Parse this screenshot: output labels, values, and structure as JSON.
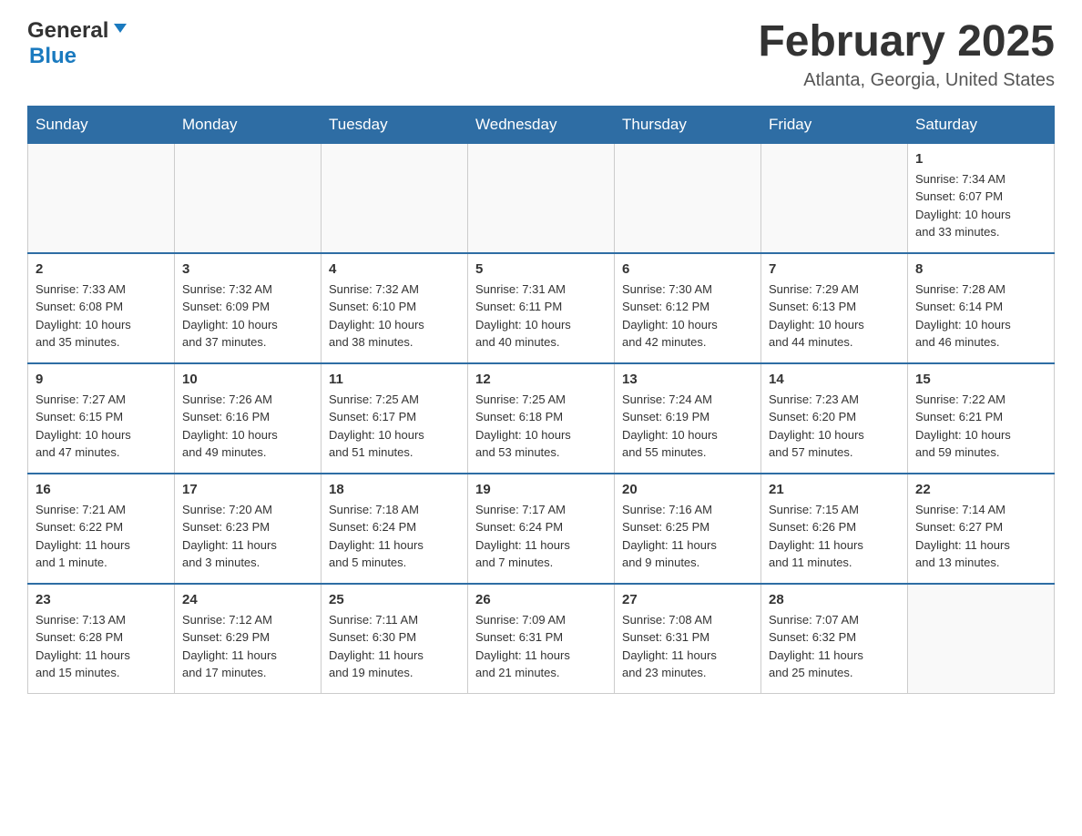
{
  "header": {
    "logo_general": "General",
    "logo_blue": "Blue",
    "month_title": "February 2025",
    "location": "Atlanta, Georgia, United States"
  },
  "weekdays": [
    "Sunday",
    "Monday",
    "Tuesday",
    "Wednesday",
    "Thursday",
    "Friday",
    "Saturday"
  ],
  "weeks": [
    {
      "days": [
        {
          "number": "",
          "info": ""
        },
        {
          "number": "",
          "info": ""
        },
        {
          "number": "",
          "info": ""
        },
        {
          "number": "",
          "info": ""
        },
        {
          "number": "",
          "info": ""
        },
        {
          "number": "",
          "info": ""
        },
        {
          "number": "1",
          "info": "Sunrise: 7:34 AM\nSunset: 6:07 PM\nDaylight: 10 hours\nand 33 minutes."
        }
      ]
    },
    {
      "days": [
        {
          "number": "2",
          "info": "Sunrise: 7:33 AM\nSunset: 6:08 PM\nDaylight: 10 hours\nand 35 minutes."
        },
        {
          "number": "3",
          "info": "Sunrise: 7:32 AM\nSunset: 6:09 PM\nDaylight: 10 hours\nand 37 minutes."
        },
        {
          "number": "4",
          "info": "Sunrise: 7:32 AM\nSunset: 6:10 PM\nDaylight: 10 hours\nand 38 minutes."
        },
        {
          "number": "5",
          "info": "Sunrise: 7:31 AM\nSunset: 6:11 PM\nDaylight: 10 hours\nand 40 minutes."
        },
        {
          "number": "6",
          "info": "Sunrise: 7:30 AM\nSunset: 6:12 PM\nDaylight: 10 hours\nand 42 minutes."
        },
        {
          "number": "7",
          "info": "Sunrise: 7:29 AM\nSunset: 6:13 PM\nDaylight: 10 hours\nand 44 minutes."
        },
        {
          "number": "8",
          "info": "Sunrise: 7:28 AM\nSunset: 6:14 PM\nDaylight: 10 hours\nand 46 minutes."
        }
      ]
    },
    {
      "days": [
        {
          "number": "9",
          "info": "Sunrise: 7:27 AM\nSunset: 6:15 PM\nDaylight: 10 hours\nand 47 minutes."
        },
        {
          "number": "10",
          "info": "Sunrise: 7:26 AM\nSunset: 6:16 PM\nDaylight: 10 hours\nand 49 minutes."
        },
        {
          "number": "11",
          "info": "Sunrise: 7:25 AM\nSunset: 6:17 PM\nDaylight: 10 hours\nand 51 minutes."
        },
        {
          "number": "12",
          "info": "Sunrise: 7:25 AM\nSunset: 6:18 PM\nDaylight: 10 hours\nand 53 minutes."
        },
        {
          "number": "13",
          "info": "Sunrise: 7:24 AM\nSunset: 6:19 PM\nDaylight: 10 hours\nand 55 minutes."
        },
        {
          "number": "14",
          "info": "Sunrise: 7:23 AM\nSunset: 6:20 PM\nDaylight: 10 hours\nand 57 minutes."
        },
        {
          "number": "15",
          "info": "Sunrise: 7:22 AM\nSunset: 6:21 PM\nDaylight: 10 hours\nand 59 minutes."
        }
      ]
    },
    {
      "days": [
        {
          "number": "16",
          "info": "Sunrise: 7:21 AM\nSunset: 6:22 PM\nDaylight: 11 hours\nand 1 minute."
        },
        {
          "number": "17",
          "info": "Sunrise: 7:20 AM\nSunset: 6:23 PM\nDaylight: 11 hours\nand 3 minutes."
        },
        {
          "number": "18",
          "info": "Sunrise: 7:18 AM\nSunset: 6:24 PM\nDaylight: 11 hours\nand 5 minutes."
        },
        {
          "number": "19",
          "info": "Sunrise: 7:17 AM\nSunset: 6:24 PM\nDaylight: 11 hours\nand 7 minutes."
        },
        {
          "number": "20",
          "info": "Sunrise: 7:16 AM\nSunset: 6:25 PM\nDaylight: 11 hours\nand 9 minutes."
        },
        {
          "number": "21",
          "info": "Sunrise: 7:15 AM\nSunset: 6:26 PM\nDaylight: 11 hours\nand 11 minutes."
        },
        {
          "number": "22",
          "info": "Sunrise: 7:14 AM\nSunset: 6:27 PM\nDaylight: 11 hours\nand 13 minutes."
        }
      ]
    },
    {
      "days": [
        {
          "number": "23",
          "info": "Sunrise: 7:13 AM\nSunset: 6:28 PM\nDaylight: 11 hours\nand 15 minutes."
        },
        {
          "number": "24",
          "info": "Sunrise: 7:12 AM\nSunset: 6:29 PM\nDaylight: 11 hours\nand 17 minutes."
        },
        {
          "number": "25",
          "info": "Sunrise: 7:11 AM\nSunset: 6:30 PM\nDaylight: 11 hours\nand 19 minutes."
        },
        {
          "number": "26",
          "info": "Sunrise: 7:09 AM\nSunset: 6:31 PM\nDaylight: 11 hours\nand 21 minutes."
        },
        {
          "number": "27",
          "info": "Sunrise: 7:08 AM\nSunset: 6:31 PM\nDaylight: 11 hours\nand 23 minutes."
        },
        {
          "number": "28",
          "info": "Sunrise: 7:07 AM\nSunset: 6:32 PM\nDaylight: 11 hours\nand 25 minutes."
        },
        {
          "number": "",
          "info": ""
        }
      ]
    }
  ]
}
